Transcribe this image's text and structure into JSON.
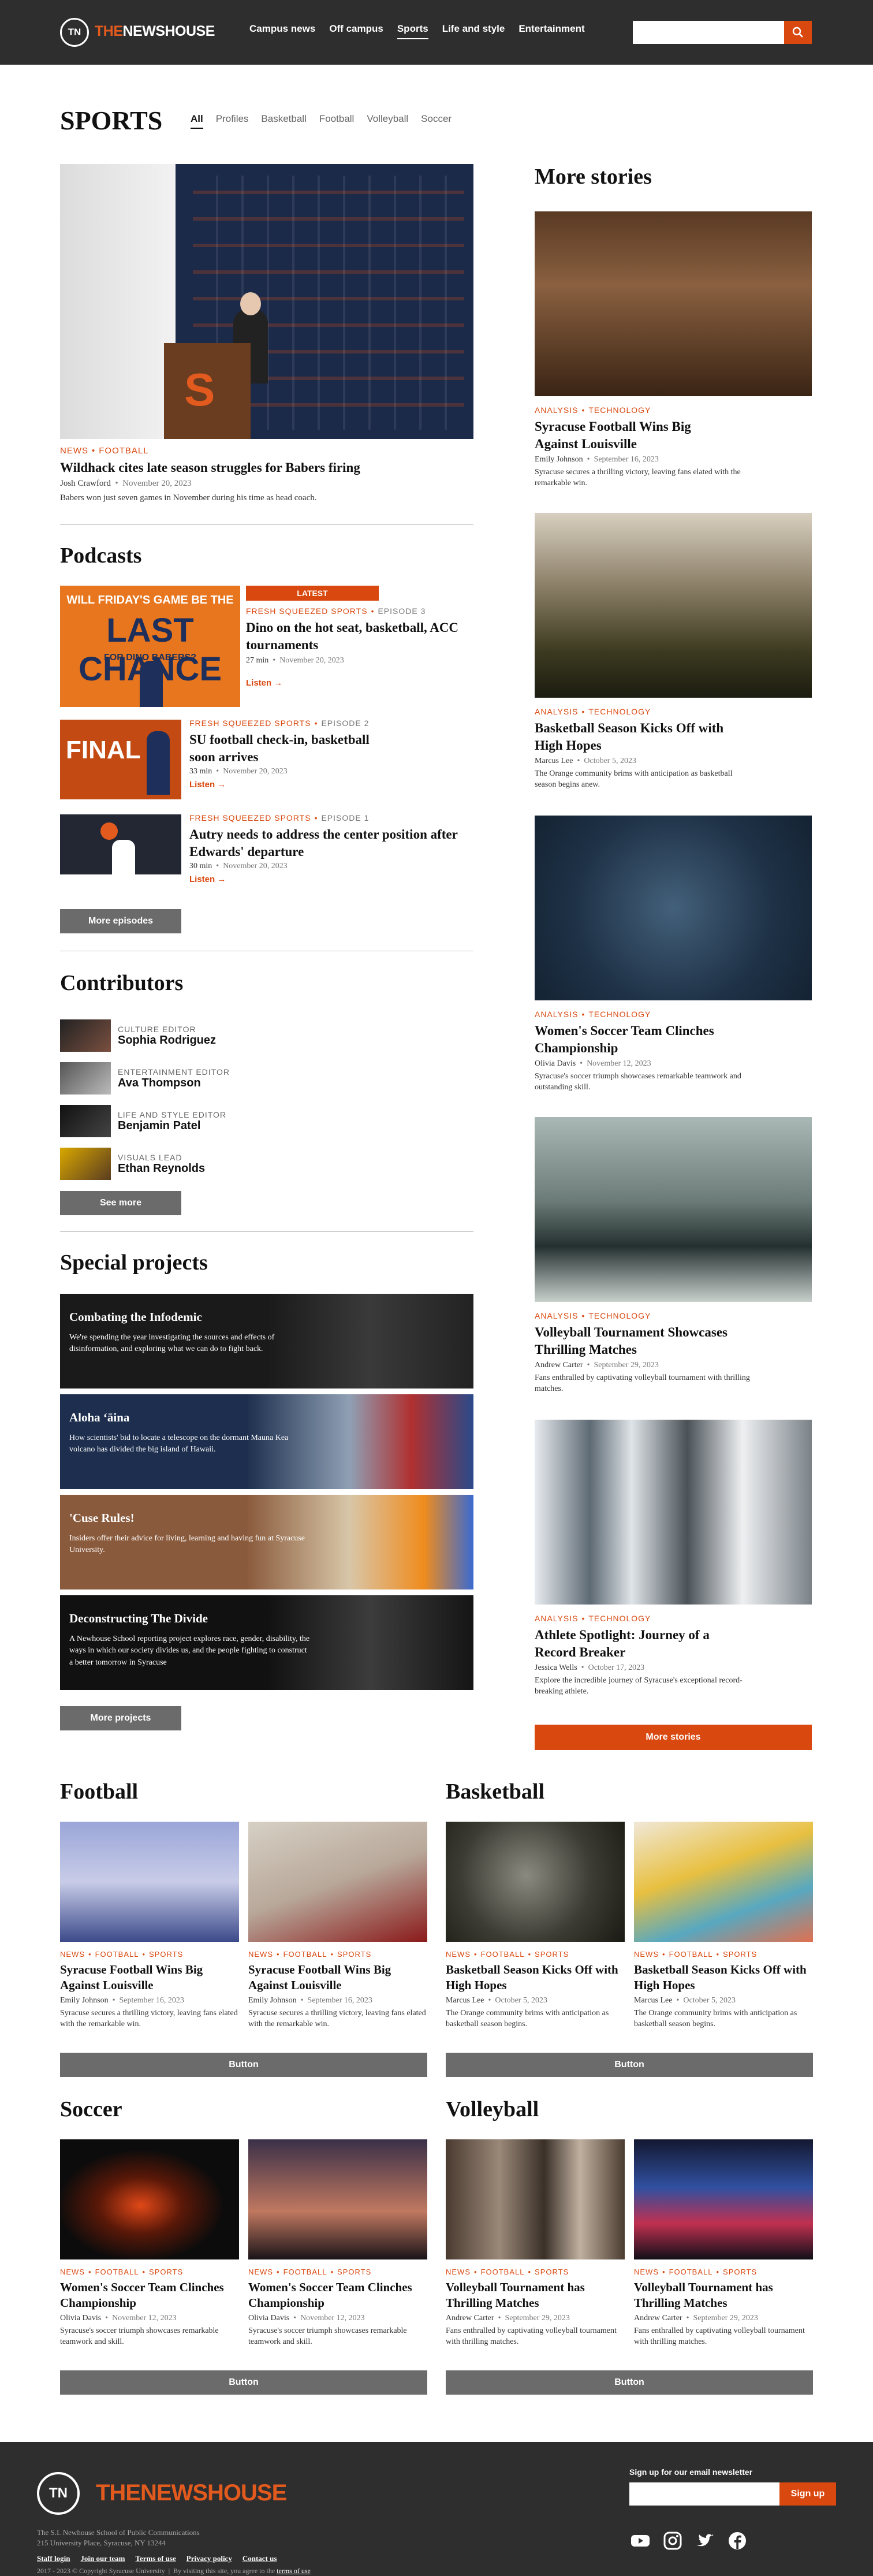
{
  "header": {
    "logo_mark": "TN",
    "logo_the": "THE",
    "logo_rest": "NEWSHOUSE",
    "nav": [
      "Campus news",
      "Off campus",
      "Sports",
      "Life and style",
      "Entertainment"
    ],
    "active_nav": "Sports",
    "search_placeholder": ""
  },
  "section": {
    "title": "SPORTS",
    "tabs": [
      "All",
      "Profiles",
      "Basketball",
      "Football",
      "Volleyball",
      "Soccer"
    ],
    "active_tab": "All"
  },
  "lead": {
    "tag1": "NEWS",
    "tag2": "FOOTBALL",
    "headline": "Wildhack cites late season struggles for Babers firing",
    "author": "Josh Crawford",
    "date": "November 20, 2023",
    "desc": "Babers won just seven games in November during his time as head coach."
  },
  "podcasts": {
    "title": "Podcasts",
    "latest_label": "LATEST",
    "items": [
      {
        "show": "FRESH SQUEEZED SPORTS",
        "episode": "EPISODE 3",
        "title": "Dino on the hot seat, basketball, ACC tournaments",
        "duration": "27 min",
        "date": "November 20, 2023",
        "listen": "Listen"
      },
      {
        "show": "FRESH SQUEEZED SPORTS",
        "episode": "EPISODE 2",
        "title": "SU football check-in, basketball soon arrives",
        "duration": "33 min",
        "date": "November 20, 2023",
        "listen": "Listen"
      },
      {
        "show": "FRESH SQUEEZED SPORTS",
        "episode": "EPISODE 1",
        "title": "Autry needs to address the center position after Edwards' departure",
        "duration": "30 min",
        "date": "November 20, 2023",
        "listen": "Listen"
      }
    ],
    "thumb1_top": "WILL FRIDAY'S GAME BE THE",
    "thumb1_big": "LAST CHANCE",
    "thumb1_sub": "FOR DINO BABERS?",
    "thumb2_big": "FINAL 5",
    "more": "More episodes"
  },
  "contributors": {
    "title": "Contributors",
    "items": [
      {
        "role": "CULTURE EDITOR",
        "name": "Sophia Rodriguez"
      },
      {
        "role": "ENTERTAINMENT EDITOR",
        "name": "Ava Thompson"
      },
      {
        "role": "LIFE AND STYLE EDITOR",
        "name": "Benjamin Patel"
      },
      {
        "role": "VISUALS LEAD",
        "name": "Ethan Reynolds"
      }
    ],
    "more": "See more"
  },
  "special": {
    "title": "Special projects",
    "items": [
      {
        "title": "Combating the Infodemic",
        "desc": "We're spending the year investigating the sources and effects of disinformation, and exploring what we can do to fight back."
      },
      {
        "title": "Aloha ʻāina",
        "desc": "How scientists' bid to locate a telescope on the dormant Mauna Kea volcano has divided the big island of Hawaii."
      },
      {
        "title": "'Cuse Rules!",
        "desc": "Insiders offer their advice for living, learning and having fun at Syracuse University."
      },
      {
        "title": "Deconstructing The Divide",
        "desc": "A Newhouse School reporting project explores race, gender, disability, the ways in which our society divides us, and the people fighting to construct a better tomorrow in Syracuse"
      }
    ],
    "more": "More projects"
  },
  "more_stories": {
    "title": "More stories",
    "items": [
      {
        "tag1": "ANALYSIS",
        "tag2": "TECHNOLOGY",
        "headline": "Syracuse Football Wins Big Against Louisville",
        "author": "Emily Johnson",
        "date": "September 16, 2023",
        "desc": "Syracuse secures a thrilling victory, leaving fans elated with the remarkable win."
      },
      {
        "tag1": "ANALYSIS",
        "tag2": "TECHNOLOGY",
        "headline": "Basketball Season Kicks Off with High Hopes",
        "author": "Marcus Lee",
        "date": "October 5, 2023",
        "desc": "The Orange community brims with anticipation as basketball season begins anew."
      },
      {
        "tag1": "ANALYSIS",
        "tag2": "TECHNOLOGY",
        "headline": "Women's Soccer Team Clinches Championship",
        "author": "Olivia Davis",
        "date": "November 12, 2023",
        "desc": "Syracuse's soccer triumph showcases remarkable teamwork and outstanding skill."
      },
      {
        "tag1": "ANALYSIS",
        "tag2": "TECHNOLOGY",
        "headline": "Volleyball Tournament Showcases Thrilling Matches",
        "author": "Andrew Carter",
        "date": "September 29, 2023",
        "desc": "Fans enthralled by captivating volleyball tournament with thrilling matches."
      },
      {
        "tag1": "ANALYSIS",
        "tag2": "TECHNOLOGY",
        "headline": "Athlete Spotlight: Journey of a Record Breaker",
        "author": "Jessica Wells",
        "date": "October 17, 2023",
        "desc": "Explore the incredible journey of Syracuse's exceptional record-breaking athlete."
      }
    ],
    "more": "More stories"
  },
  "grids": [
    {
      "title": "Football",
      "button": "Button",
      "cards": [
        {
          "t1": "NEWS",
          "t2": "FOOTBALL",
          "t3": "SPORTS",
          "headline": "Syracuse Football Wins Big Against Louisville",
          "author": "Emily Johnson",
          "date": "September 16, 2023",
          "desc": "Syracuse secures a thrilling victory, leaving fans elated with the remarkable win."
        },
        {
          "t1": "NEWS",
          "t2": "FOOTBALL",
          "t3": "SPORTS",
          "headline": "Syracuse Football Wins Big Against Louisville",
          "author": "Emily Johnson",
          "date": "September 16, 2023",
          "desc": "Syracuse secures a thrilling victory, leaving fans elated with the remarkable win."
        }
      ]
    },
    {
      "title": "Basketball",
      "button": "Button",
      "cards": [
        {
          "t1": "NEWS",
          "t2": "FOOTBALL",
          "t3": "SPORTS",
          "headline": "Basketball Season Kicks Off with High Hopes",
          "author": "Marcus Lee",
          "date": "October 5, 2023",
          "desc": "The Orange community brims with anticipation as basketball season begins."
        },
        {
          "t1": "NEWS",
          "t2": "FOOTBALL",
          "t3": "SPORTS",
          "headline": "Basketball Season Kicks Off with High Hopes",
          "author": "Marcus Lee",
          "date": "October 5, 2023",
          "desc": "The Orange community brims with anticipation as basketball season begins."
        }
      ]
    },
    {
      "title": "Soccer",
      "button": "Button",
      "cards": [
        {
          "t1": "NEWS",
          "t2": "FOOTBALL",
          "t3": "SPORTS",
          "headline": "Women's Soccer Team Clinches Championship",
          "author": "Olivia Davis",
          "date": "November 12, 2023",
          "desc": "Syracuse's soccer triumph showcases remarkable teamwork and skill."
        },
        {
          "t1": "NEWS",
          "t2": "FOOTBALL",
          "t3": "SPORTS",
          "headline": "Women's Soccer Team Clinches Championship",
          "author": "Olivia Davis",
          "date": "November 12, 2023",
          "desc": "Syracuse's soccer triumph showcases remarkable teamwork and skill."
        }
      ]
    },
    {
      "title": "Volleyball",
      "button": "Button",
      "cards": [
        {
          "t1": "NEWS",
          "t2": "FOOTBALL",
          "t3": "SPORTS",
          "headline": "Volleyball Tournament has Thrilling Matches",
          "author": "Andrew Carter",
          "date": "September 29, 2023",
          "desc": "Fans enthralled by captivating volleyball tournament with thrilling matches."
        },
        {
          "t1": "NEWS",
          "t2": "FOOTBALL",
          "t3": "SPORTS",
          "headline": "Volleyball Tournament has Thrilling Matches",
          "author": "Andrew Carter",
          "date": "September 29, 2023",
          "desc": "Fans enthralled by captivating volleyball tournament with thrilling matches."
        }
      ]
    }
  ],
  "footer": {
    "logo_mark": "TN",
    "logo_the": "THE",
    "logo_rest": "NEWSHOUSE",
    "org": "The S.I. Newhouse School of Public Communications",
    "address": "215 University Place, Syracuse, NY 13244",
    "links": [
      "Staff login",
      "Join our team",
      "Terms of use",
      "Privacy policy",
      "Contact us"
    ],
    "copyright": "2017 - 2023 © Copyright Syracuse University",
    "agree_prefix": "By visiting this site, you agree to the",
    "agree_link": "terms of use",
    "newsletter_label": "Sign up for our email newsletter",
    "signup": "Sign up",
    "socials": [
      "youtube-icon",
      "instagram-icon",
      "twitter-icon",
      "facebook-icon"
    ]
  },
  "colors": {
    "accent": "#d9480f",
    "dark": "#2e2e2e",
    "button_gray": "#6b6b6b"
  }
}
